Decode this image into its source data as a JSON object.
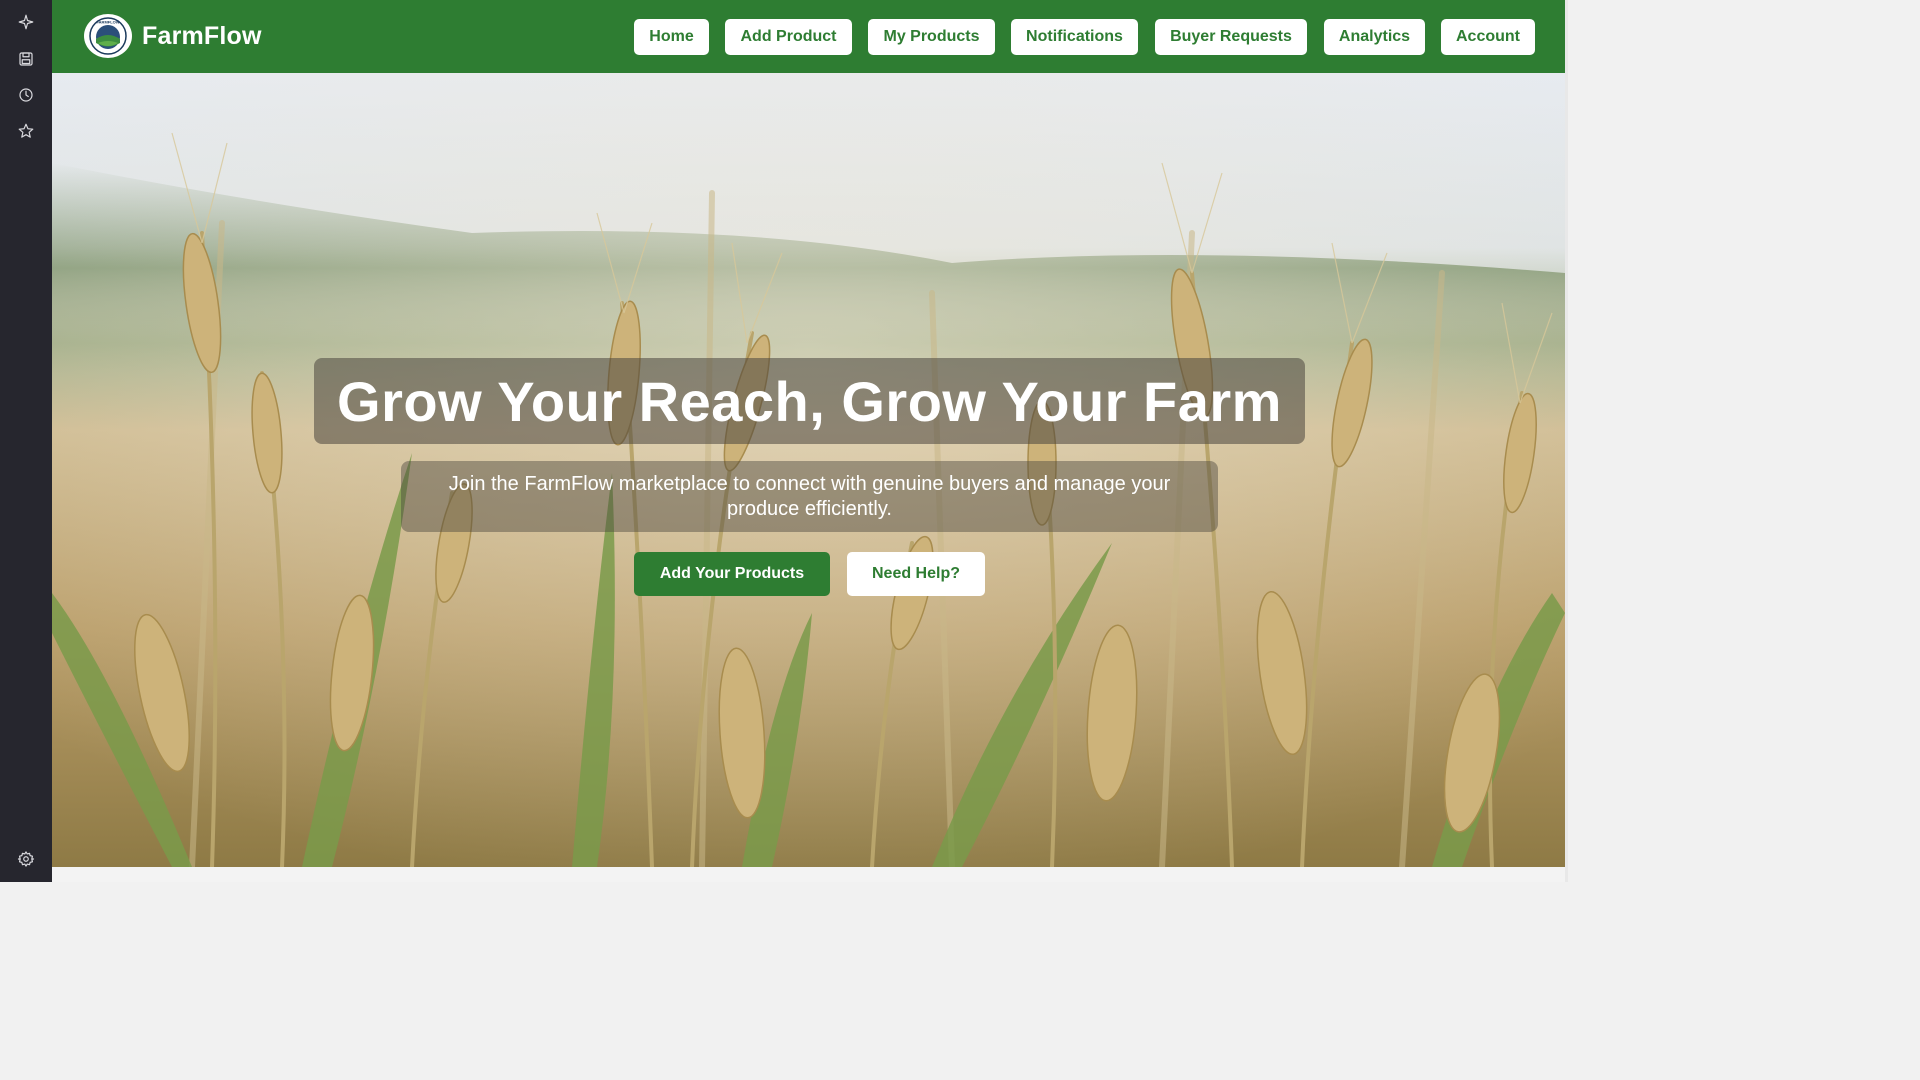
{
  "rail": {
    "icons": [
      "sparkle-icon",
      "save-icon",
      "history-icon",
      "star-icon",
      "settings-icon"
    ]
  },
  "header": {
    "brand": "FarmFlow",
    "logo_text": "FARMFLOW",
    "nav": [
      "Home",
      "Add Product",
      "My Products",
      "Notifications",
      "Buyer Requests",
      "Analytics",
      "Account"
    ]
  },
  "hero": {
    "title": "Grow Your Reach, Grow Your Farm",
    "subtitle": "Join the FarmFlow marketplace to connect with genuine buyers and manage your produce efficiently.",
    "primary_cta": "Add Your Products",
    "secondary_cta": "Need Help?"
  },
  "colors": {
    "brand_green": "#2e7d32",
    "rail_bg": "#26262e",
    "white": "#ffffff"
  }
}
